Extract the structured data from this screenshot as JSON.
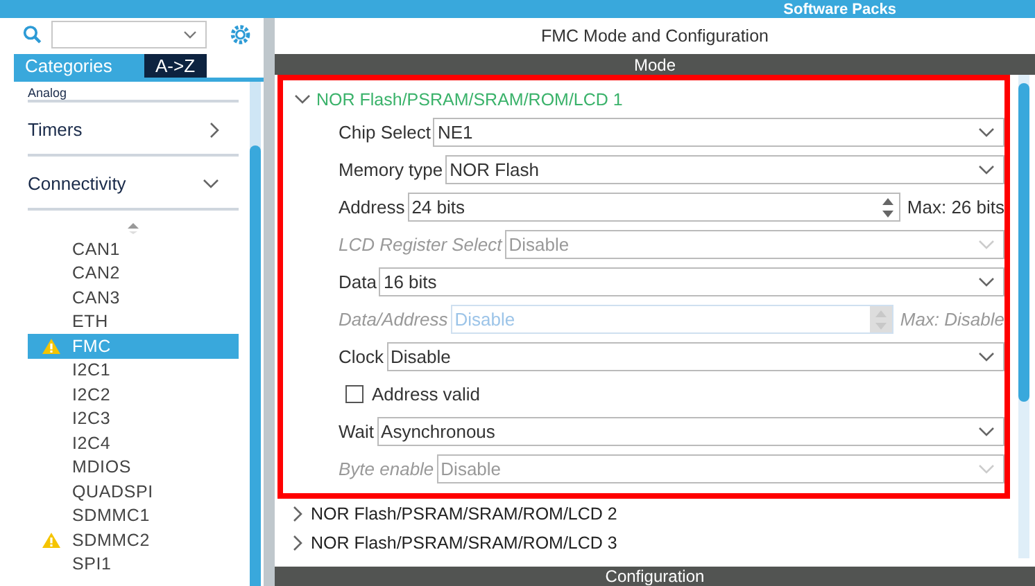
{
  "header": {
    "title": "Software Packs"
  },
  "sidebar": {
    "tabs": [
      {
        "label": "Categories",
        "selected": true
      },
      {
        "label": "A->Z",
        "selected": false
      }
    ],
    "categories": [
      {
        "label": "Analog"
      },
      {
        "label": "Timers",
        "expanded": false
      },
      {
        "label": "Connectivity",
        "expanded": true,
        "children": [
          {
            "label": "CAN1",
            "selected": false,
            "warning": false
          },
          {
            "label": "CAN2",
            "selected": false,
            "warning": false
          },
          {
            "label": "CAN3",
            "selected": false,
            "warning": false
          },
          {
            "label": "ETH",
            "selected": false,
            "warning": false
          },
          {
            "label": "FMC",
            "selected": true,
            "warning": true
          },
          {
            "label": "I2C1",
            "selected": false,
            "warning": false
          },
          {
            "label": "I2C2",
            "selected": false,
            "warning": false
          },
          {
            "label": "I2C3",
            "selected": false,
            "warning": false
          },
          {
            "label": "I2C4",
            "selected": false,
            "warning": false
          },
          {
            "label": "MDIOS",
            "selected": false,
            "warning": false
          },
          {
            "label": "QUADSPI",
            "selected": false,
            "warning": false
          },
          {
            "label": "SDMMC1",
            "selected": false,
            "warning": false
          },
          {
            "label": "SDMMC2",
            "selected": false,
            "warning": true
          },
          {
            "label": "SPI1",
            "selected": false,
            "warning": false
          }
        ]
      }
    ]
  },
  "panel": {
    "title": "FMC Mode and Configuration",
    "mode_header": "Mode",
    "groups": [
      {
        "label": "NOR Flash/PSRAM/SRAM/ROM/LCD 1",
        "expanded": true,
        "highlighted": true,
        "fields": [
          {
            "kind": "select",
            "label": "Chip Select",
            "value": "NE1",
            "disabled": false
          },
          {
            "kind": "select",
            "label": "Memory type",
            "value": "NOR Flash",
            "disabled": false
          },
          {
            "kind": "spin",
            "label": "Address",
            "value": "24 bits",
            "max": "Max: 26 bits",
            "disabled": false
          },
          {
            "kind": "select",
            "label": "LCD Register Select",
            "value": "Disable",
            "disabled": true
          },
          {
            "kind": "select",
            "label": "Data",
            "value": "16 bits",
            "disabled": false
          },
          {
            "kind": "spin",
            "label": "Data/Address",
            "value": "Disable",
            "max": "Max: Disable",
            "disabled": true
          },
          {
            "kind": "select",
            "label": "Clock",
            "value": "Disable",
            "disabled": false
          },
          {
            "kind": "checkbox",
            "label": "Address valid",
            "checked": false
          },
          {
            "kind": "select",
            "label": "Wait",
            "value": "Asynchronous",
            "disabled": false
          },
          {
            "kind": "select",
            "label": "Byte enable",
            "value": "Disable",
            "disabled": true
          }
        ]
      },
      {
        "label": "NOR Flash/PSRAM/SRAM/ROM/LCD 2",
        "expanded": false,
        "highlighted": false
      },
      {
        "label": "NOR Flash/PSRAM/SRAM/ROM/LCD 3",
        "expanded": false,
        "highlighted": false
      }
    ],
    "config_header": "Configuration"
  }
}
